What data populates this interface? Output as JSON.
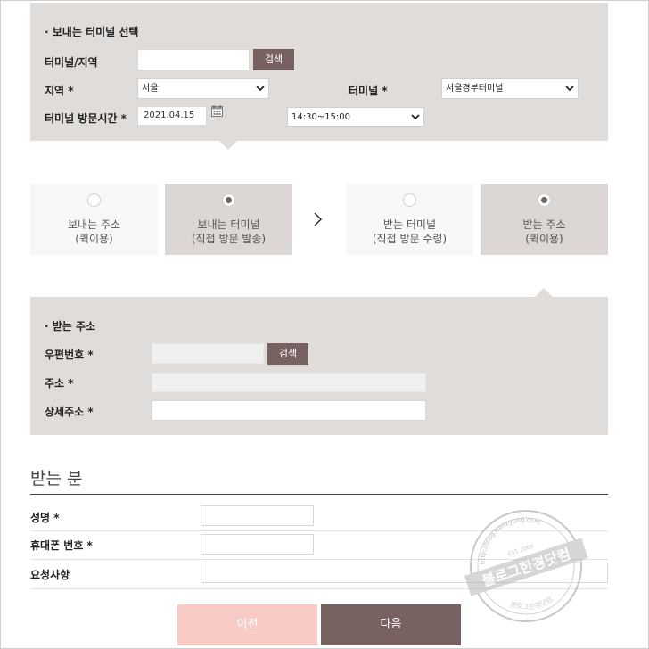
{
  "sender": {
    "section_title": "· 보내는 터미널 선택",
    "terminal_region_label": "터미널/지역",
    "terminal_region_value": "",
    "search_label": "검색",
    "region_label": "지역 *",
    "region_value": "서울",
    "terminal_label": "터미널 *",
    "terminal_value": "서울경부터미널",
    "visit_label": "터미널 방문시간 *",
    "visit_date": "2021.04.15",
    "visit_time": "14:30~15:00"
  },
  "options": [
    {
      "line1": "보내는 주소",
      "line2": "(퀵이용)",
      "selected": false
    },
    {
      "line1": "보내는 터미널",
      "line2": "(직접 방문 발송)",
      "selected": true
    },
    {
      "line1": "받는 터미널",
      "line2": "(직접 방문 수령)",
      "selected": false
    },
    {
      "line1": "받는 주소",
      "line2": "(퀵이용)",
      "selected": true
    }
  ],
  "receiver_address": {
    "section_title": "· 받는 주소",
    "postcode_label": "우편번호 *",
    "postcode_value": "",
    "search_label": "검색",
    "address_label": "주소 *",
    "address_value": "",
    "detail_label": "상세주소 *",
    "detail_value": ""
  },
  "recipient": {
    "title": "받는 분",
    "name_label": "성명 *",
    "name_value": "",
    "phone_label": "휴대폰 번호 *",
    "phone_value": "",
    "request_label": "요청사항",
    "request_value": ""
  },
  "buttons": {
    "prev": "이전",
    "next": "다음"
  },
  "watermark": {
    "main": "블로그한경닷컴",
    "url": "http://blog.hankyung.com",
    "est": "EST. 2009"
  },
  "colors": {
    "panel_bg": "#e0dcd9",
    "accent_brown": "#776261",
    "prev_pink": "#f9cbc6"
  }
}
